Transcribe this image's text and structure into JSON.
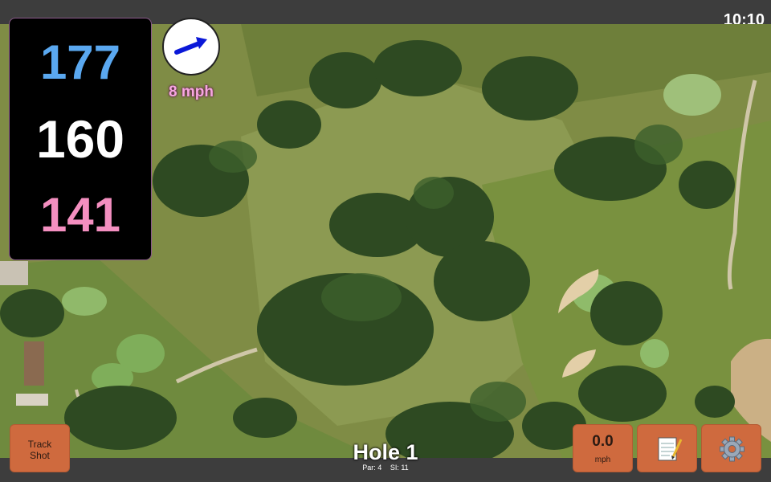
{
  "status": {
    "time": "10:10"
  },
  "distances": {
    "back": "177",
    "middle": "160",
    "front": "141"
  },
  "wind": {
    "speed_label": "8 mph",
    "direction_icon": "arrow-right-icon"
  },
  "hole": {
    "title": "Hole 1",
    "par_label": "Par: 4",
    "si_label": "SI: 11"
  },
  "buttons": {
    "track_shot_line1": "Track",
    "track_shot_line2": "Shot",
    "speed_value": "0.0",
    "speed_unit": "mph",
    "notes_icon": "notepad-icon",
    "settings_icon": "gear-icon"
  },
  "colors": {
    "back": "#5aa8f0",
    "middle": "#ffffff",
    "front": "#f48fc0",
    "wind_text": "#f7a6e0",
    "button": "#cf6a3e",
    "bar": "#3d3d3d"
  }
}
